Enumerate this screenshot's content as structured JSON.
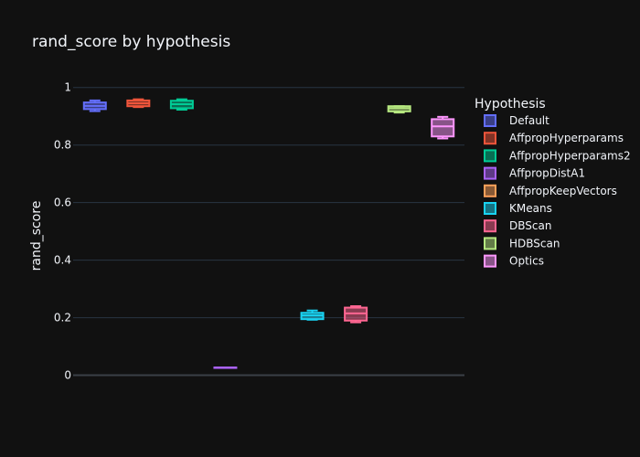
{
  "chart_data": {
    "type": "box",
    "title": "rand_score by hypothesis",
    "xlabel": "",
    "ylabel": "rand_score",
    "ylim": [
      -0.03,
      1.05
    ],
    "yticks": [
      0,
      0.2,
      0.4,
      0.6,
      0.8,
      1
    ],
    "ytick_labels": [
      "0",
      "0.2",
      "0.4",
      "0.6",
      "0.8",
      "1"
    ],
    "grid": true,
    "legend_title": "Hypothesis",
    "legend_position": "right",
    "series": [
      {
        "name": "Default",
        "color": "#636efa",
        "min": 0.918,
        "q1": 0.925,
        "median": 0.936,
        "q3": 0.948,
        "max": 0.955
      },
      {
        "name": "AffpropHyperparams",
        "color": "#ef553b",
        "min": 0.932,
        "q1": 0.935,
        "median": 0.945,
        "q3": 0.955,
        "max": 0.959
      },
      {
        "name": "AffpropHyperparams2",
        "color": "#00cc96",
        "min": 0.923,
        "q1": 0.928,
        "median": 0.942,
        "q3": 0.954,
        "max": 0.959
      },
      {
        "name": "AffpropDistA1",
        "color": "#ab63fa",
        "min": 0.027,
        "q1": 0.027,
        "median": 0.027,
        "q3": 0.027,
        "max": 0.027
      },
      {
        "name": "AffpropKeepVectors",
        "color": "#ffa15a",
        "min": null,
        "q1": null,
        "median": null,
        "q3": null,
        "max": null
      },
      {
        "name": "KMeans",
        "color": "#19d3f3",
        "min": 0.193,
        "q1": 0.195,
        "median": 0.208,
        "q3": 0.217,
        "max": 0.225
      },
      {
        "name": "DBScan",
        "color": "#ff6692",
        "min": 0.184,
        "q1": 0.19,
        "median": 0.215,
        "q3": 0.235,
        "max": 0.24
      },
      {
        "name": "HDBScan",
        "color": "#b6e880",
        "min": 0.913,
        "q1": 0.917,
        "median": 0.928,
        "q3": 0.935,
        "max": 0.935
      },
      {
        "name": "Optics",
        "color": "#ff97ff",
        "min": 0.823,
        "q1": 0.83,
        "median": 0.865,
        "q3": 0.89,
        "max": 0.898
      }
    ]
  }
}
